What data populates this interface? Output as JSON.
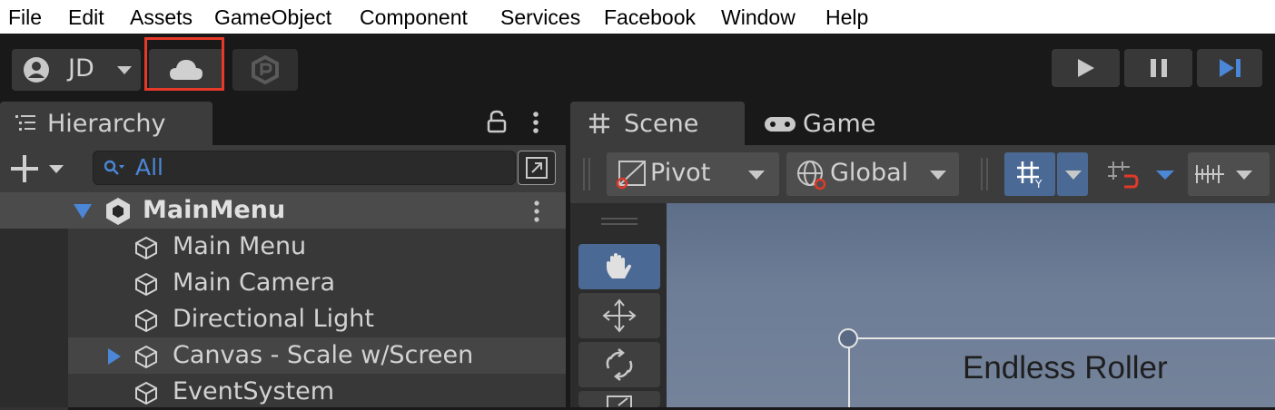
{
  "menu": [
    "File",
    "Edit",
    "Assets",
    "GameObject",
    "Component",
    "Services",
    "Facebook",
    "Window",
    "Help"
  ],
  "toolbar": {
    "account_label": "JD"
  },
  "hierarchy": {
    "tab_label": "Hierarchy",
    "search_placeholder": "All",
    "rows": [
      {
        "label": "MainMenu"
      },
      {
        "label": "Main Menu"
      },
      {
        "label": "Main Camera"
      },
      {
        "label": "Directional Light"
      },
      {
        "label": "Canvas - Scale w/Screen"
      },
      {
        "label": "EventSystem"
      }
    ]
  },
  "scene": {
    "tabs": [
      "Scene",
      "Game"
    ],
    "pivot_label": "Pivot",
    "global_label": "Global",
    "canvas_text": "Endless Roller"
  },
  "colors": {
    "highlight": "#e53a29",
    "selection": "#4b87d6",
    "background": "#191919",
    "panel": "#3c3c3c"
  }
}
